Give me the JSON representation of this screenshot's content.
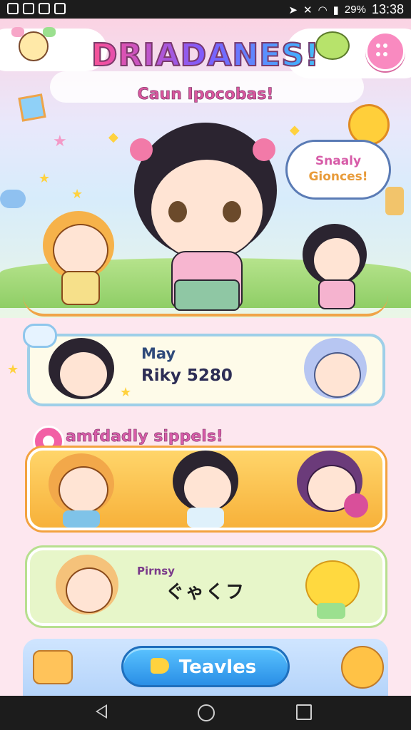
{
  "status_bar": {
    "battery": "29%",
    "time": "13:38"
  },
  "header": {
    "title": "DRIADANES!",
    "subtitle": "Caun Iросоbas!"
  },
  "speech_bubble": {
    "line1": "Snaaly",
    "line2": "Gionces!"
  },
  "player_card": {
    "name": "May",
    "score": "Riky 5280"
  },
  "friends_section": {
    "label": "amfdadly sippels!"
  },
  "friend_card": {
    "small": "Pirnsy",
    "big": "ぐゃくフ"
  },
  "play_button": {
    "label": "Teavles"
  },
  "colors": {
    "accent_pink": "#f25fa5",
    "accent_blue": "#2a8fe6",
    "accent_orange": "#f7b13a",
    "accent_green": "#b7df8f"
  }
}
